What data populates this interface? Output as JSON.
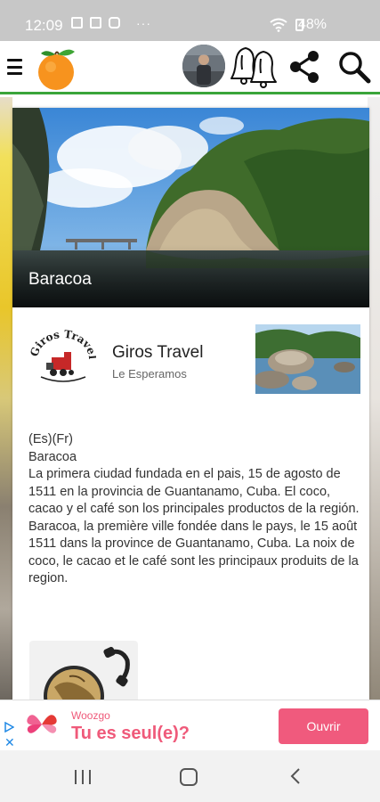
{
  "status_bar": {
    "time": "12:09",
    "battery": "48%"
  },
  "app_bar": {
    "icons": [
      "menu-icon",
      "orange-logo",
      "avatar",
      "bells-icon",
      "share-icon",
      "search-icon"
    ]
  },
  "hero": {
    "title": "Baracoa"
  },
  "business": {
    "name": "Giros Travel",
    "tagline": "Le Esperamos",
    "logo_text": "Giros Travel"
  },
  "description": {
    "lang_tag": "(Es)(Fr)",
    "heading": "Baracoa",
    "spanish": "La primera ciudad fundada en el pais, 15 de agosto de 1511 en la provincia de Guantanamo, Cuba. El coco, cacao y el café son los principales productos de la región.",
    "french": "Baracoa, la première ville fondée dans le pays, le 15 août 1511 dans la province de Guantanamo, Cuba. La noix de coco, le cacao et le café sont les principaux produits de la region."
  },
  "ad": {
    "brand": "Woozgo",
    "headline": "Tu es seul(e)?",
    "cta": "Ouvrir"
  },
  "colors": {
    "accent_green": "#3aa53a",
    "ad_pink": "#f05a7d",
    "status_bar": "#c7c7c7"
  }
}
